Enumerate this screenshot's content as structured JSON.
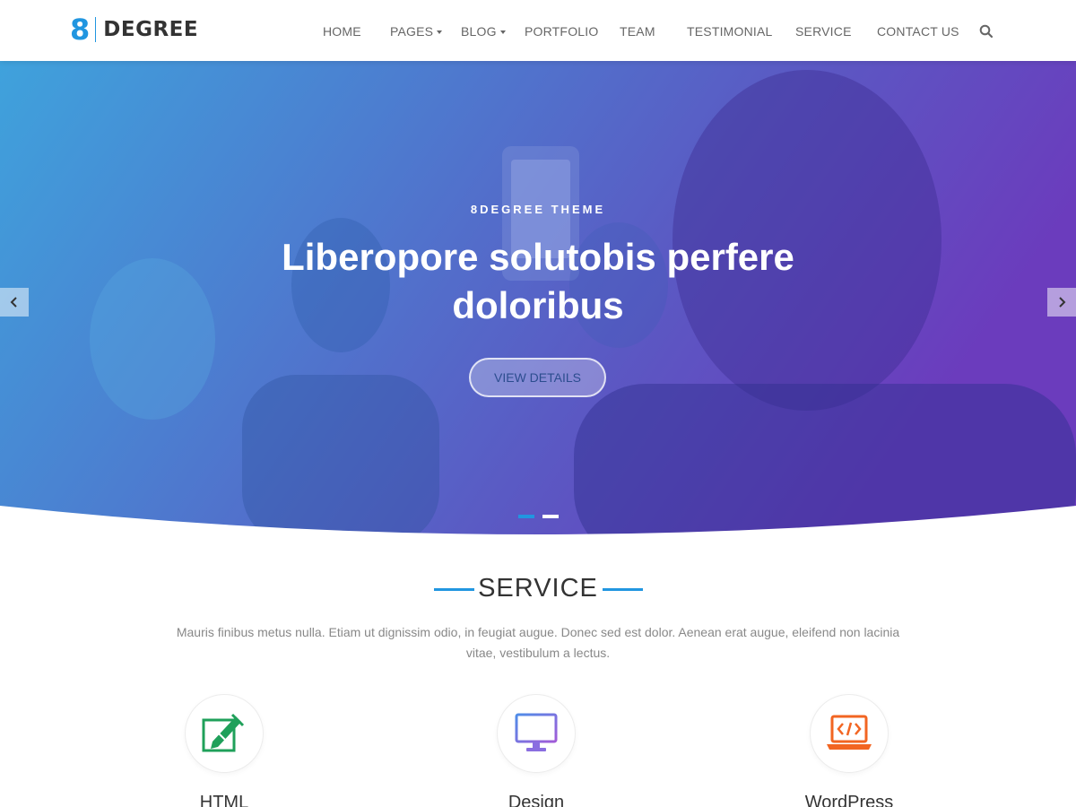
{
  "brand": {
    "number": "8",
    "name": "DEGREE",
    "accent": "#2196e0"
  },
  "nav": {
    "items": [
      {
        "label": "HOME",
        "has_dropdown": false
      },
      {
        "label": "PAGES",
        "has_dropdown": true
      },
      {
        "label": "BLOG",
        "has_dropdown": true
      },
      {
        "label": "PORTFOLIO",
        "has_dropdown": false
      },
      {
        "label": "TEAM",
        "has_dropdown": false
      },
      {
        "label": "TESTIMONIAL",
        "has_dropdown": false
      },
      {
        "label": "SERVICE",
        "has_dropdown": false
      },
      {
        "label": "CONTACT US",
        "has_dropdown": false
      }
    ],
    "search_icon": "search-icon"
  },
  "hero": {
    "subtitle": "8DEGREE THEME",
    "title": "Liberopore solutobis perfere doloribus",
    "button_label": "VIEW DETAILS",
    "prev_icon": "chevron-left-icon",
    "next_icon": "chevron-right-icon",
    "slides": 2,
    "active_slide": 1,
    "gradient": [
      "#3a9ad9",
      "#6a3fbe"
    ]
  },
  "service": {
    "title": "SERVICE",
    "description": "Mauris finibus metus nulla. Etiam ut dignissim odio, in feugiat augue. Donec sed est dolor. Aenean erat augue, eleifend non lacinia vitae, vestibulum a lectus.",
    "items": [
      {
        "label": "HTML",
        "icon": "pen-edit-icon",
        "color": "#1fa05a"
      },
      {
        "label": "Design",
        "icon": "monitor-icon",
        "color": "#7b6fe6"
      },
      {
        "label": "WordPress",
        "icon": "laptop-code-icon",
        "color": "#f26522"
      }
    ]
  }
}
